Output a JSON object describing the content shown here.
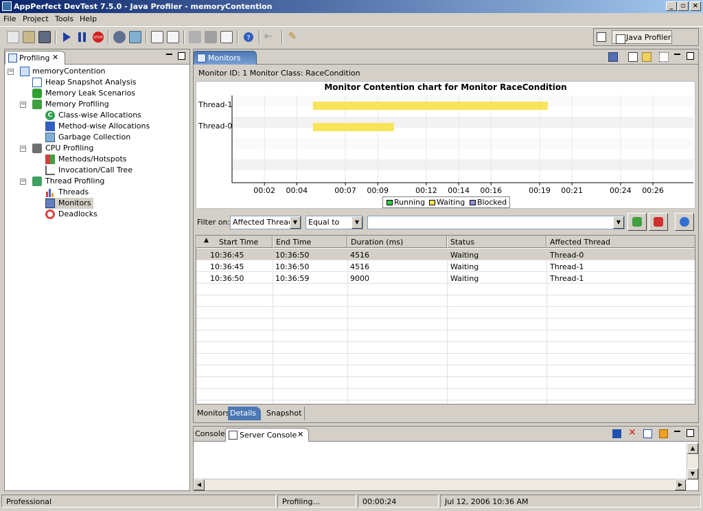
{
  "window": {
    "title": "AppPerfect DevTest 7.5.0 - Java Profiler - memoryContention"
  },
  "menu": [
    "File",
    "Project",
    "Tools",
    "Help"
  ],
  "perspective": {
    "label": "Java Profiler"
  },
  "left_panel": {
    "tab_label": "Profiling",
    "tree": [
      {
        "label": "memoryContention",
        "icon": "project-icon"
      },
      {
        "label": "Heap Snapshot Analysis",
        "icon": "heap-icon"
      },
      {
        "label": "Memory Leak Scenarios",
        "icon": "leak-icon"
      },
      {
        "label": "Memory Profiling",
        "icon": "memory-icon"
      },
      {
        "label": "Class-wise Allocations",
        "icon": "class-icon"
      },
      {
        "label": "Method-wise Allocations",
        "icon": "method-icon"
      },
      {
        "label": "Garbage Collection",
        "icon": "gc-icon"
      },
      {
        "label": "CPU Profiling",
        "icon": "cpu-icon"
      },
      {
        "label": "Methods/Hotspots",
        "icon": "hotspot-icon"
      },
      {
        "label": "Invocation/Call Tree",
        "icon": "calltree-icon"
      },
      {
        "label": "Thread Profiling",
        "icon": "thread-icon"
      },
      {
        "label": "Threads",
        "icon": "threads-chart-icon"
      },
      {
        "label": "Monitors",
        "icon": "monitor-icon"
      },
      {
        "label": "Deadlocks",
        "icon": "deadlock-icon"
      }
    ]
  },
  "editor": {
    "tab_label": "Monitors",
    "monitor_info": "Monitor ID: 1 Monitor Class: RaceCondition"
  },
  "chart_data": {
    "type": "bar",
    "title": "Monitor Contention chart for Monitor RaceCondition",
    "orientation": "horizontal",
    "categories": [
      "Thread-1",
      "Thread-0"
    ],
    "x_ticks": [
      "00:02",
      "00:04",
      "00:07",
      "00:09",
      "00:12",
      "00:14",
      "00:16",
      "00:19",
      "00:21",
      "00:24",
      "00:26"
    ],
    "x_tick_seconds": [
      2,
      4,
      7,
      9,
      12,
      14,
      16,
      19,
      21,
      24,
      26
    ],
    "xlim": [
      0,
      28.5
    ],
    "bars": [
      {
        "thread": "Thread-1",
        "start": 5,
        "end": 19.5,
        "state": "Waiting"
      },
      {
        "thread": "Thread-0",
        "start": 5,
        "end": 10
      }
    ],
    "legend": [
      {
        "label": "Running",
        "color": "#2dc843"
      },
      {
        "label": "Waiting",
        "color": "#f8e45a"
      },
      {
        "label": "Blocked",
        "color": "#9090d8"
      }
    ],
    "legend_position": "bottom"
  },
  "filter": {
    "label": "Filter on:",
    "field": "Affected Thread",
    "operator": "Equal to",
    "value": ""
  },
  "table": {
    "columns": [
      "Start Time",
      "End Time",
      "Duration (ms)",
      "Status",
      "Affected Thread"
    ],
    "rows": [
      [
        "10:36:45",
        "10:36:50",
        "4516",
        "Waiting",
        "Thread-0"
      ],
      [
        "10:36:45",
        "10:36:50",
        "4516",
        "Waiting",
        "Thread-1"
      ],
      [
        "10:36:50",
        "10:36:59",
        "9000",
        "Waiting",
        "Thread-1"
      ]
    ]
  },
  "bottom_tabs": [
    "Monitors",
    "Details",
    "Snapshot"
  ],
  "console": {
    "tabs": [
      "Console",
      "Server Console"
    ]
  },
  "status": {
    "edition": "Professional",
    "state": "Profiling...",
    "elapsed": "00:00:24",
    "datetime": "Jul 12, 2006 10:36 AM"
  }
}
